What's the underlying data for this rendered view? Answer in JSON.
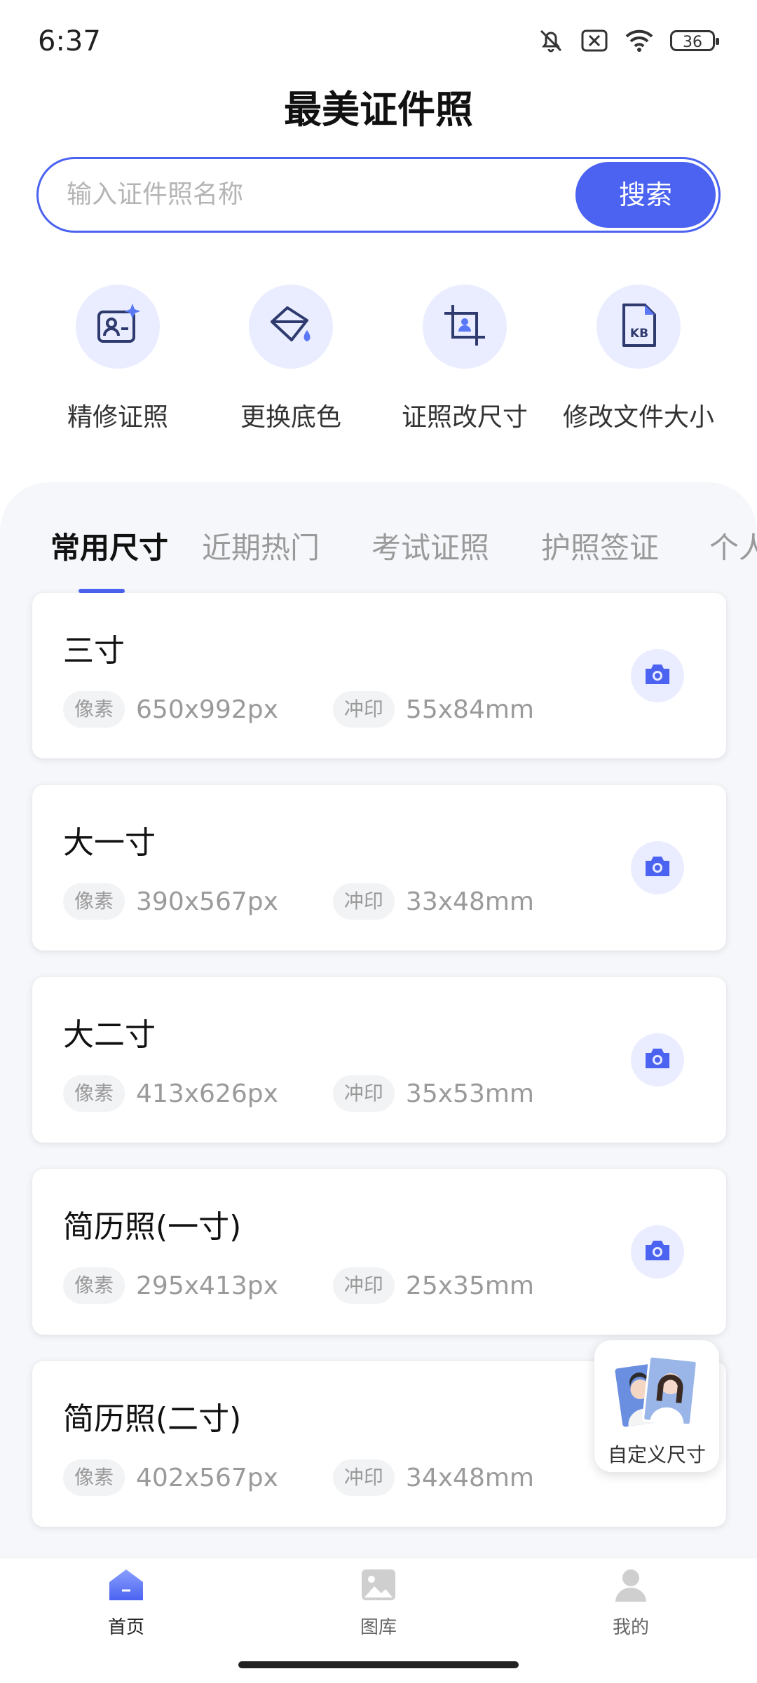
{
  "status_bar": {
    "time": "6:37",
    "battery": "36"
  },
  "app_title": "最美证件照",
  "search": {
    "placeholder": "输入证件照名称",
    "button": "搜索"
  },
  "tools": [
    {
      "label": "精修证照",
      "icon": "portrait-retouch-icon"
    },
    {
      "label": "更换底色",
      "icon": "paint-bucket-icon"
    },
    {
      "label": "证照改尺寸",
      "icon": "crop-icon"
    },
    {
      "label": "修改文件大小",
      "icon": "kb-file-icon"
    }
  ],
  "tabs": [
    {
      "label": "常用尺寸",
      "active": true
    },
    {
      "label": "近期热门"
    },
    {
      "label": "考试证照"
    },
    {
      "label": "护照签证"
    },
    {
      "label": "个人"
    }
  ],
  "cards": [
    {
      "name": "三寸",
      "pixel_label": "像素",
      "pixels": "650x992px",
      "print_label": "冲印",
      "print": "55x84mm"
    },
    {
      "name": "大一寸",
      "pixel_label": "像素",
      "pixels": "390x567px",
      "print_label": "冲印",
      "print": "33x48mm"
    },
    {
      "name": "大二寸",
      "pixel_label": "像素",
      "pixels": "413x626px",
      "print_label": "冲印",
      "print": "35x53mm"
    },
    {
      "name": "简历照(一寸)",
      "pixel_label": "像素",
      "pixels": "295x413px",
      "print_label": "冲印",
      "print": "25x35mm"
    },
    {
      "name": "简历照(二寸)",
      "pixel_label": "像素",
      "pixels": "402x567px",
      "print_label": "冲印",
      "print": "34x48mm"
    }
  ],
  "float_button": {
    "label": "自定义尺寸"
  },
  "bottom_nav": [
    {
      "label": "首页",
      "icon": "home-icon",
      "active": true
    },
    {
      "label": "图库",
      "icon": "gallery-icon"
    },
    {
      "label": "我的",
      "icon": "profile-icon"
    }
  ],
  "colors": {
    "accent": "#4b63f0",
    "accent_light": "#e9edff",
    "panel_bg": "#f5f7fb"
  }
}
